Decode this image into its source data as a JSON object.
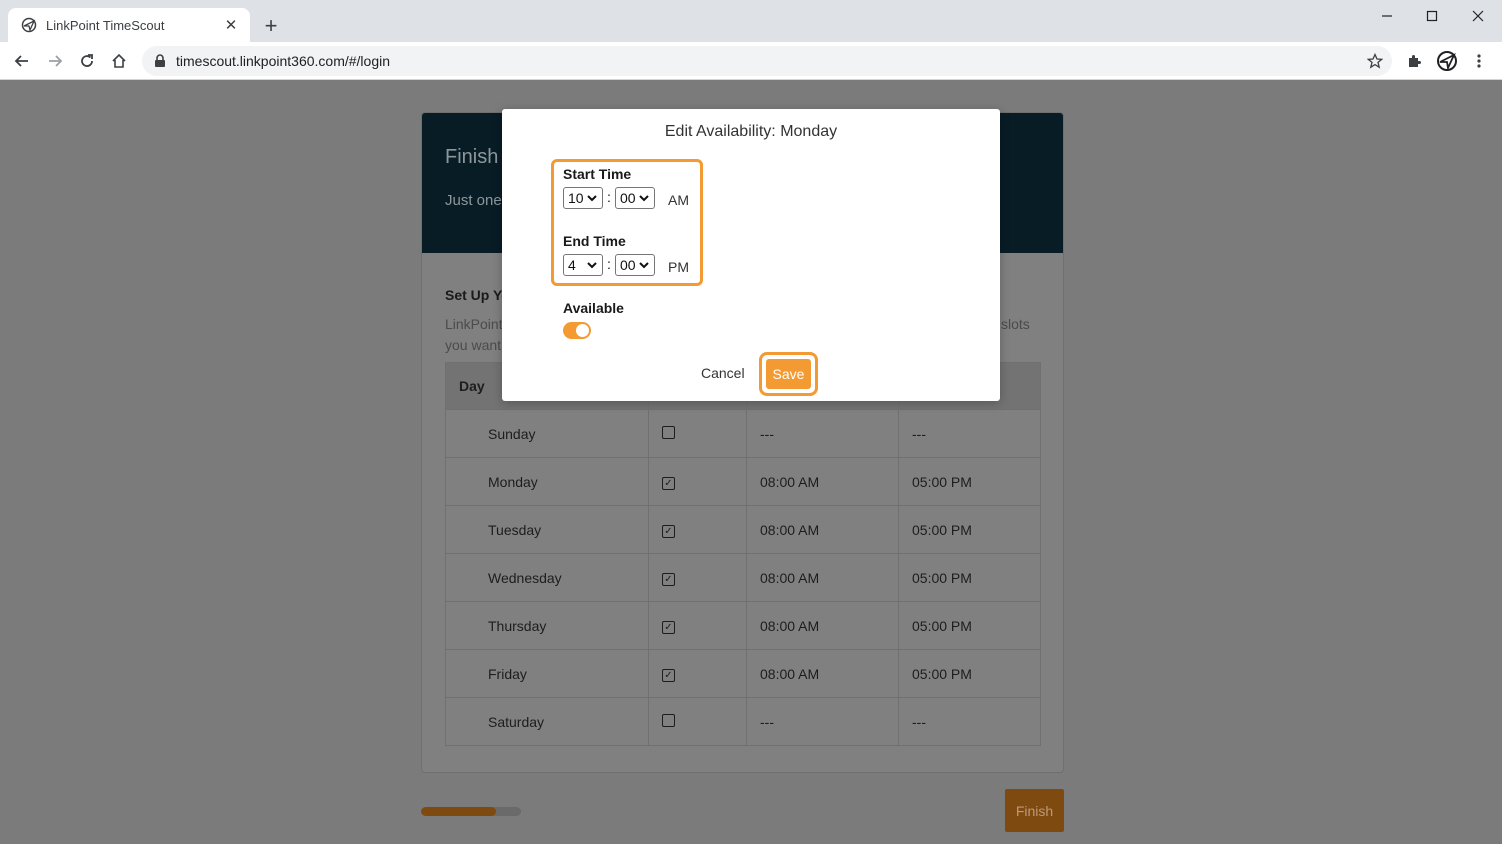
{
  "browser": {
    "tab_title": "LinkPoint TimeScout",
    "url": "timescout.linkpoint360.com/#/login"
  },
  "page": {
    "card_title": "Finish",
    "card_subtitle": "Just one",
    "section_title": "Set Up Yo",
    "section_desc_line1": "LinkPoint",
    "section_desc_line1_end": "slots",
    "section_desc_line2": "you want",
    "table": {
      "header_day": "Day",
      "rows": [
        {
          "day": "Sunday",
          "available": false,
          "start": "---",
          "end": "---"
        },
        {
          "day": "Monday",
          "available": true,
          "start": "08:00 AM",
          "end": "05:00 PM"
        },
        {
          "day": "Tuesday",
          "available": true,
          "start": "08:00 AM",
          "end": "05:00 PM"
        },
        {
          "day": "Wednesday",
          "available": true,
          "start": "08:00 AM",
          "end": "05:00 PM"
        },
        {
          "day": "Thursday",
          "available": true,
          "start": "08:00 AM",
          "end": "05:00 PM"
        },
        {
          "day": "Friday",
          "available": true,
          "start": "08:00 AM",
          "end": "05:00 PM"
        },
        {
          "day": "Saturday",
          "available": false,
          "start": "---",
          "end": "---"
        }
      ]
    },
    "progress_percent": 75,
    "finish_label": "Finish"
  },
  "modal": {
    "title": "Edit Availability: Monday",
    "start_label": "Start Time",
    "start_hour": "10",
    "start_minute": "00",
    "start_ampm": "AM",
    "end_label": "End Time",
    "end_hour": "4",
    "end_minute": "00",
    "end_ampm": "PM",
    "colon": ":",
    "available_label": "Available",
    "available_on": true,
    "cancel_label": "Cancel",
    "save_label": "Save"
  },
  "colors": {
    "accent": "#f39a33",
    "header_dark": "#081c26"
  }
}
